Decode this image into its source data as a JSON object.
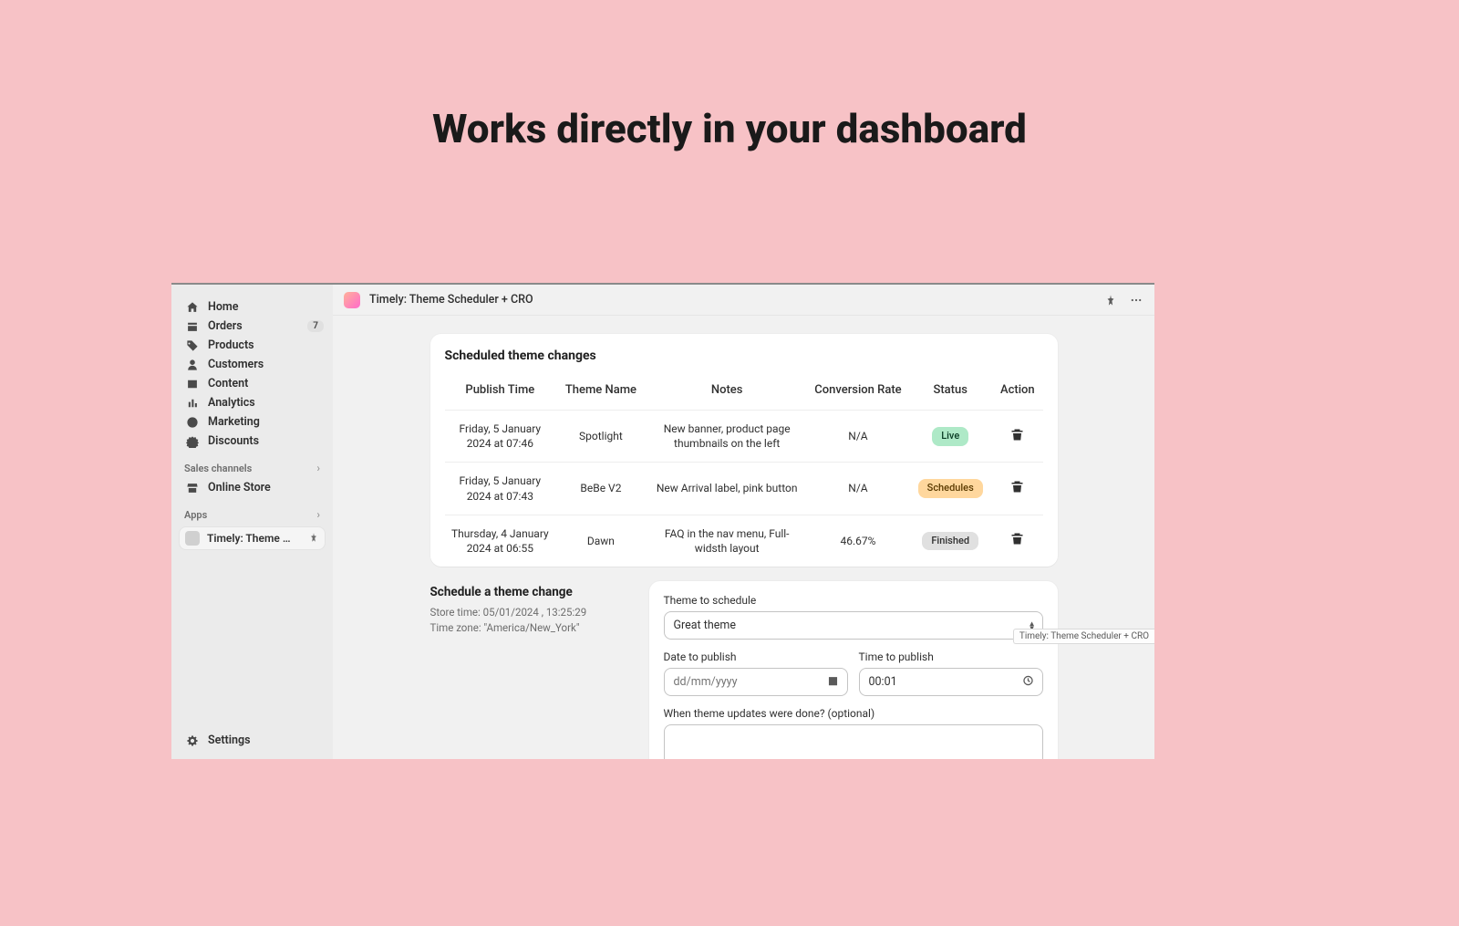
{
  "headline": "Works directly in your dashboard",
  "topbar": {
    "app_title": "Timely: Theme Scheduler + CRO"
  },
  "sidebar": {
    "nav": [
      {
        "label": "Home",
        "icon": "home"
      },
      {
        "label": "Orders",
        "icon": "orders",
        "badge": "7"
      },
      {
        "label": "Products",
        "icon": "products"
      },
      {
        "label": "Customers",
        "icon": "customers"
      },
      {
        "label": "Content",
        "icon": "content"
      },
      {
        "label": "Analytics",
        "icon": "analytics"
      },
      {
        "label": "Marketing",
        "icon": "marketing"
      },
      {
        "label": "Discounts",
        "icon": "discounts"
      }
    ],
    "section_sales": "Sales channels",
    "sales_items": [
      {
        "label": "Online Store",
        "icon": "onlinestore"
      }
    ],
    "section_apps": "Apps",
    "apps_items": [
      {
        "label": "Timely: Theme Sched..."
      }
    ],
    "settings": "Settings"
  },
  "scheduled": {
    "title": "Scheduled theme changes",
    "columns": [
      "Publish Time",
      "Theme Name",
      "Notes",
      "Conversion Rate",
      "Status",
      "Action"
    ],
    "rows": [
      {
        "time": "Friday, 5 January 2024 at 07:46",
        "theme": "Spotlight",
        "notes": "New banner, product page thumbnails on the left",
        "rate": "N/A",
        "status": "Live",
        "status_kind": "live"
      },
      {
        "time": "Friday, 5 January 2024 at 07:43",
        "theme": "BeBe V2",
        "notes": "New Arrival label, pink button",
        "rate": "N/A",
        "status": "Schedules",
        "status_kind": "schedules"
      },
      {
        "time": "Thursday, 4 January 2024 at 06:55",
        "theme": "Dawn",
        "notes": "FAQ in the nav menu, Full-widsth layout",
        "rate": "46.67%",
        "status": "Finished",
        "status_kind": "finished"
      }
    ]
  },
  "schedule_form": {
    "heading": "Schedule a theme change",
    "store_time": "Store time: 05/01/2024 , 13:25:29",
    "time_zone": "Time zone: \"America/New_York\"",
    "theme_label": "Theme to schedule",
    "theme_value": "Great theme",
    "date_label": "Date to publish",
    "date_placeholder": "dd/mm/yyyy",
    "time_label": "Time to publish",
    "time_value": "00:01",
    "notes_label": "When theme updates were done? (optional)"
  },
  "tooltip": "Timely: Theme Scheduler + CRO"
}
